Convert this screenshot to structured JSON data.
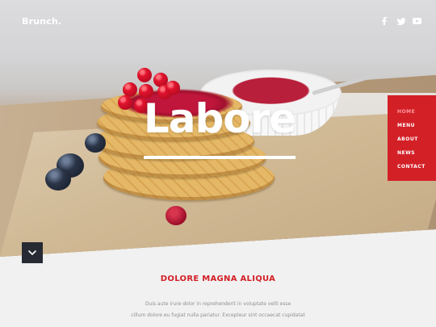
{
  "header": {
    "logo": "Brunch.",
    "social_icons": [
      "facebook-icon",
      "twitter-icon",
      "youtube-icon"
    ]
  },
  "hero": {
    "headline": "Labore"
  },
  "nav": {
    "items": [
      {
        "label": "HOME",
        "active": true
      },
      {
        "label": "MENU",
        "active": false
      },
      {
        "label": "ABOUT",
        "active": false
      },
      {
        "label": "NEWS",
        "active": false
      },
      {
        "label": "CONTACT",
        "active": false
      }
    ]
  },
  "scroll_button": {
    "icon": "chevron-down-icon"
  },
  "section": {
    "title": "DOLORE MAGNA ALIQUA",
    "lines": [
      "Duis aute irure dolor in reprehenderit in voluptate velit esse",
      "cillum dolore eu fugiat nulla pariatur. Excepteur sint occaecat cupidatat"
    ]
  },
  "colors": {
    "accent": "#d32027",
    "dark_button": "#282a33",
    "text_muted": "#8f8f8f"
  }
}
